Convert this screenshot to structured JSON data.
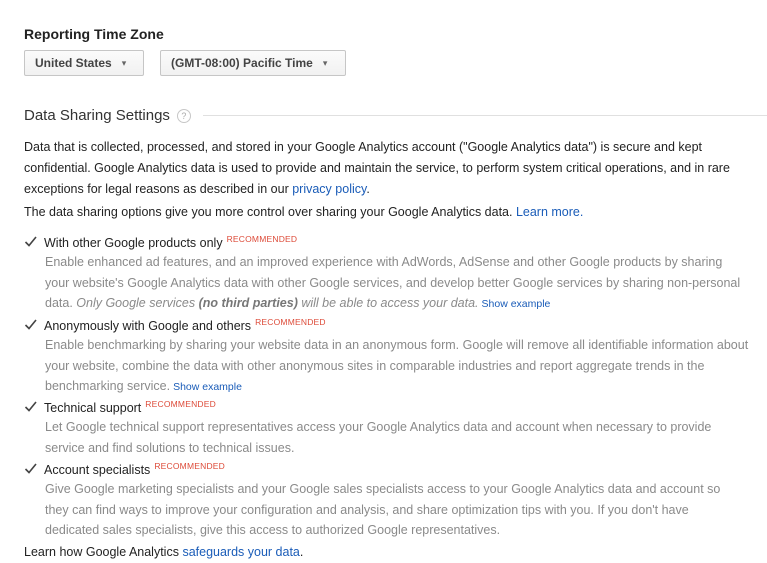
{
  "timezone": {
    "title": "Reporting Time Zone",
    "country": "United States",
    "zone": "(GMT-08:00) Pacific Time",
    "arrow": "▾"
  },
  "data_sharing": {
    "title": "Data Sharing Settings",
    "help": "?",
    "intro": {
      "line1": "Data that is collected, processed, and stored in your Google Analytics account (\"Google Analytics data\") is secure and kept",
      "line2": "confidential. Google Analytics data is used to provide and maintain the service, to perform system critical operations, and in rare",
      "line3_prefix": "exceptions for legal reasons as described in our ",
      "privacy_link": "privacy policy",
      "line3_suffix": "."
    },
    "options_intro": {
      "text": "The data sharing options give you more control over sharing your Google Analytics data. ",
      "learn_more": "Learn more."
    },
    "recommended_label": "RECOMMENDED",
    "options": [
      {
        "label": "With other Google products only",
        "checked": true,
        "line1": "Enable enhanced ad features, and an improved experience with AdWords, AdSense and other Google products by sharing",
        "line2": "your website's Google Analytics data with other Google services, and develop better Google services by sharing non-personal",
        "line3_prefix": "data. ",
        "line3_italic1": "Only Google services ",
        "line3_bold": "(no third parties)",
        "line3_italic2": " will be able to access your data.",
        "show_example": "Show example"
      },
      {
        "label": "Anonymously with Google and others",
        "checked": true,
        "line1": "Enable benchmarking by sharing your website data in an anonymous form. Google will remove all identifiable information about",
        "line2": "your website, combine the data with other anonymous sites in comparable industries and report aggregate trends in the",
        "line3": "benchmarking service.",
        "show_example": "Show example"
      },
      {
        "label": "Technical support",
        "checked": true,
        "line1": "Let Google technical support representatives access your Google Analytics data and account when necessary to provide",
        "line2": "service and find solutions to technical issues."
      },
      {
        "label": "Account specialists",
        "checked": true,
        "line1": "Give Google marketing specialists and your Google sales specialists access to your Google Analytics data and account so",
        "line2": "they can find ways to improve your configuration and analysis, and share optimization tips with you. If you don't have",
        "line3": "dedicated sales specialists, give this access to authorized Google representatives."
      }
    ],
    "footer": {
      "prefix": "Learn how Google Analytics ",
      "link": "safeguards your data",
      "suffix": "."
    }
  },
  "colors": {
    "link": "#1a5cb8",
    "recommended": "#dd4b39",
    "description": "#8a8a8a"
  }
}
